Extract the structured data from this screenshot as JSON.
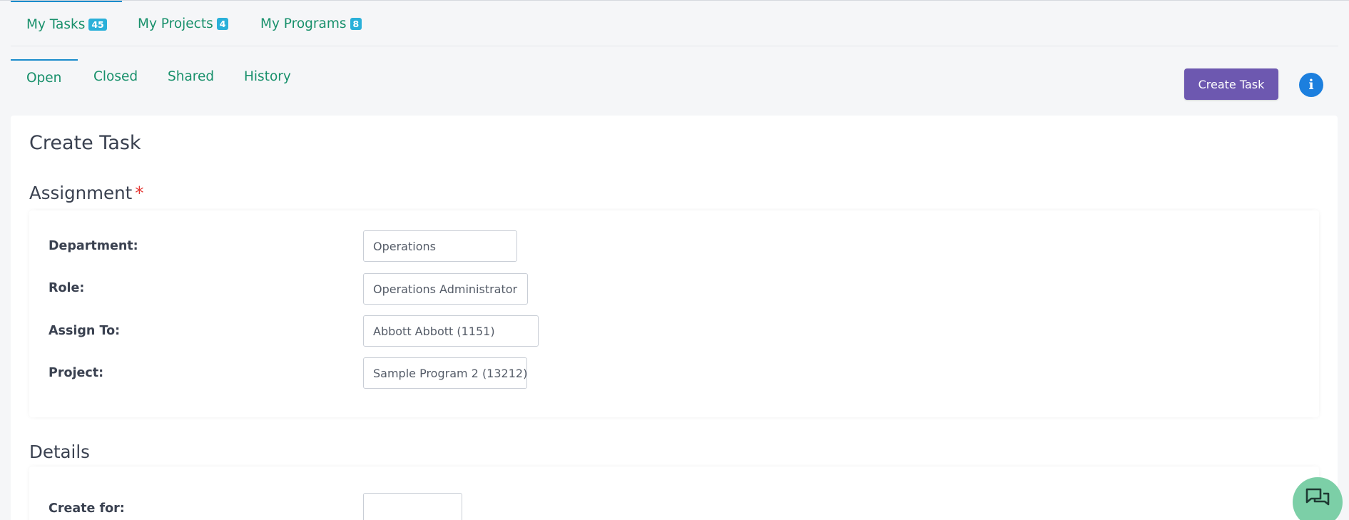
{
  "top_tabs": [
    {
      "label": "My Tasks",
      "badge": "45"
    },
    {
      "label": "My Projects",
      "badge": "4"
    },
    {
      "label": "My Programs",
      "badge": "8"
    }
  ],
  "sub_tabs": [
    "Open",
    "Closed",
    "Shared",
    "History"
  ],
  "actions": {
    "create_task_label": "Create Task",
    "info_icon": "i"
  },
  "card": {
    "title": "Create Task",
    "assignment": {
      "title": "Assignment",
      "required_mark": "*",
      "fields": [
        {
          "label": "Department:",
          "value": "Operations"
        },
        {
          "label": "Role:",
          "value": "Operations Administrator"
        },
        {
          "label": "Assign To:",
          "value": "Abbott Abbott (1151)"
        },
        {
          "label": "Project:",
          "value": "Sample Program 2 (13212)"
        }
      ]
    },
    "details": {
      "title": "Details",
      "fields": [
        {
          "label": "Create for:",
          "value": ""
        }
      ]
    }
  },
  "colors": {
    "accent_green": "#18906b",
    "primary_purple": "#6d58b0",
    "info_blue": "#1c7fde",
    "badge_blue": "#2ab0d9",
    "chat_green": "#7ccfa7"
  }
}
